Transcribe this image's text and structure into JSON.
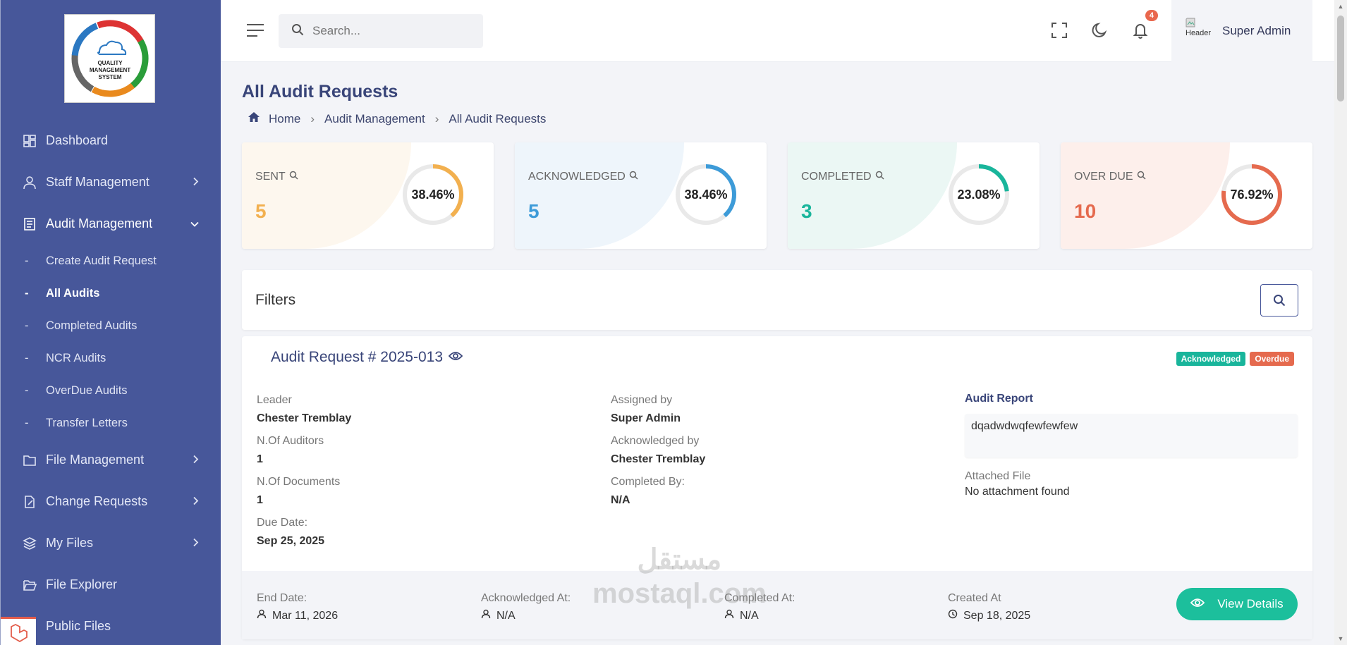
{
  "sidebar": {
    "logo_text": "QUALITY MANAGEMENT SYSTEM",
    "items": [
      {
        "label": "Dashboard",
        "icon": "dashboard-icon"
      },
      {
        "label": "Staff Management",
        "icon": "user-icon"
      },
      {
        "label": "Audit Management",
        "icon": "document-icon"
      },
      {
        "label": "File Management",
        "icon": "folder-icon"
      },
      {
        "label": "Change Requests",
        "icon": "edit-file-icon"
      },
      {
        "label": "My Files",
        "icon": "layers-icon"
      },
      {
        "label": "File Explorer",
        "icon": "folder-open-icon"
      },
      {
        "label": "Public Files",
        "icon": "folder-icon"
      }
    ],
    "sub_items": [
      {
        "label": "Create Audit Request"
      },
      {
        "label": "All Audits"
      },
      {
        "label": "Completed Audits"
      },
      {
        "label": "NCR Audits"
      },
      {
        "label": "OverDue Audits"
      },
      {
        "label": "Transfer Letters"
      }
    ]
  },
  "header": {
    "search_placeholder": "Search...",
    "notification_count": "4",
    "avatar_alt": "Header",
    "user_name": "Super Admin"
  },
  "page": {
    "title": "All Audit Requests",
    "breadcrumb": [
      "Home",
      "Audit Management",
      "All Audit Requests"
    ]
  },
  "stats": [
    {
      "label": "SENT",
      "value": "5",
      "percent": "38.46%",
      "fraction": 0.3846,
      "color": "#f2b04f",
      "bg": "#fdf7ee"
    },
    {
      "label": "ACKNOWLEDGED",
      "value": "5",
      "percent": "38.46%",
      "fraction": 0.3846,
      "color": "#3d9bd8",
      "bg": "#eef5fb"
    },
    {
      "label": "COMPLETED",
      "value": "3",
      "percent": "23.08%",
      "fraction": 0.2308,
      "color": "#19b59b",
      "bg": "#ebf7f4"
    },
    {
      "label": "OVER DUE",
      "value": "10",
      "percent": "76.92%",
      "fraction": 0.7692,
      "color": "#e56a4e",
      "bg": "#fdefeb"
    }
  ],
  "filters": {
    "title": "Filters"
  },
  "audit": {
    "title": "Audit Request # 2025-013",
    "tags": [
      {
        "label": "Acknowledged",
        "color": "#19b59b"
      },
      {
        "label": "Overdue",
        "color": "#e56a4e"
      }
    ],
    "leader_label": "Leader",
    "leader": "Chester Tremblay",
    "auditors_label": "N.Of Auditors",
    "auditors": "1",
    "documents_label": "N.Of Documents",
    "documents": "1",
    "due_label": "Due Date:",
    "due": "Sep 25, 2025",
    "assigned_label": "Assigned by",
    "assigned": "Super Admin",
    "ack_by_label": "Acknowledged by",
    "ack_by": "Chester Tremblay",
    "completed_by_label": "Completed By:",
    "completed_by": "N/A",
    "report_label": "Audit Report",
    "report": "dqadwdwqfewfewfew",
    "attached_label": "Attached File",
    "attached": "No attachment found",
    "end_label": "End Date:",
    "end": "Mar 11, 2026",
    "ack_at_label": "Acknowledged At:",
    "ack_at": "N/A",
    "completed_at_label": "Completed At:",
    "completed_at": "N/A",
    "created_label": "Created At",
    "created": "Sep 18, 2025",
    "view_label": "View Details"
  },
  "watermark": {
    "line1": "مستقل",
    "line2": "mostaql.com"
  }
}
